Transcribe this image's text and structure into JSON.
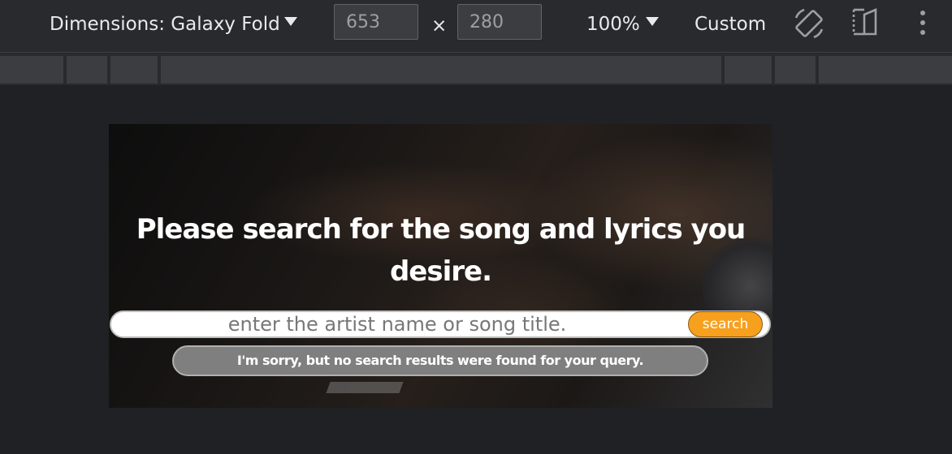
{
  "devtools": {
    "dimensions_label": "Dimensions: Galaxy Fold",
    "width_value": "653",
    "height_value": "280",
    "times_sign": "×",
    "zoom_label": "100%",
    "throttle_label": "Custom",
    "icons": [
      "chevron-down-icon",
      "rotate-icon",
      "fold-icon",
      "more-vert-icon"
    ]
  },
  "page": {
    "headline": "Please search for the song and lyrics you desire.",
    "search_placeholder": "enter the artist name or song title.",
    "search_button_label": "search",
    "no_results_message": "I'm sorry, but no search results were found for your query.",
    "accent_color": "#f7a01e"
  }
}
